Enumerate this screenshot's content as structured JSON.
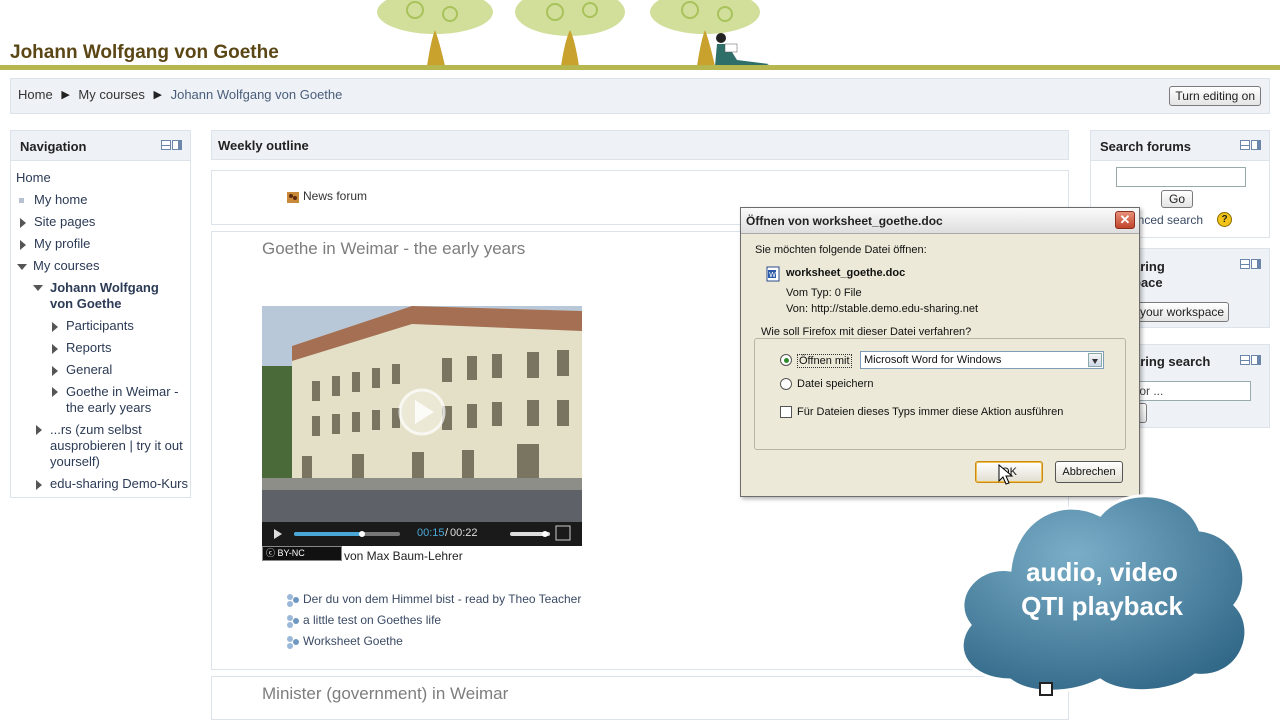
{
  "header": {
    "site_title": "Johann Wolfgang von Goethe"
  },
  "breadcrumb": {
    "items": [
      "Home",
      "My courses",
      "Johann Wolfgang von Goethe"
    ]
  },
  "edit_button": "Turn editing on",
  "navigation": {
    "title": "Navigation",
    "items": [
      {
        "label": "Home"
      },
      {
        "label": "My home"
      },
      {
        "label": "Site pages"
      },
      {
        "label": "My profile"
      },
      {
        "label": "My courses"
      },
      {
        "label": "Johann Wolfgang von Goethe"
      },
      {
        "label": "Participants"
      },
      {
        "label": "Reports"
      },
      {
        "label": "General"
      },
      {
        "label": "Goethe in Weimar - the early years"
      },
      {
        "label": "...rs (zum selbst ausprobieren | try it out yourself)"
      },
      {
        "label": "edu-sharing Demo-Kurs"
      }
    ]
  },
  "main": {
    "outline_title": "Weekly outline",
    "news_forum": "News forum",
    "section1_title": "Goethe in Weimar - the early years",
    "video": {
      "time_current": "00:15",
      "time_total": "00:22",
      "license": "BY-NC",
      "byline": "von Max Baum-Lehrer"
    },
    "activities": [
      "Der du von dem Himmel bist - read by Theo Teacher",
      "a little test on Goethes life",
      "Worksheet Goethe"
    ],
    "section2_title": "Minister (government) in Weimar"
  },
  "right": {
    "search_forums": {
      "title": "Search forums",
      "go_button": "Go",
      "advanced": "anced search"
    },
    "edu_sharing": {
      "title_line1": "aring",
      "title_line2": "pace",
      "button": "your workspace"
    },
    "edu_search": {
      "title": "aring search",
      "placeholder": "for  ..."
    }
  },
  "dialog": {
    "title": "Öffnen von worksheet_goethe.doc",
    "intro": "Sie möchten folgende Datei öffnen:",
    "filename": "worksheet_goethe.doc",
    "type_line": "Vom Typ:  0 File",
    "from_line": "Von:  http://stable.demo.edu-sharing.net",
    "question": "Wie soll Firefox mit dieser Datei verfahren?",
    "open_with": "Öffnen mit",
    "app": "Microsoft Word for Windows",
    "save_file": "Datei speichern",
    "always": "Für Dateien dieses Typs immer diese Aktion ausführen",
    "ok_label": "OK",
    "cancel_label": "Abbrechen"
  },
  "cloud": {
    "line1": "audio, video",
    "line2": "QTI playback"
  }
}
